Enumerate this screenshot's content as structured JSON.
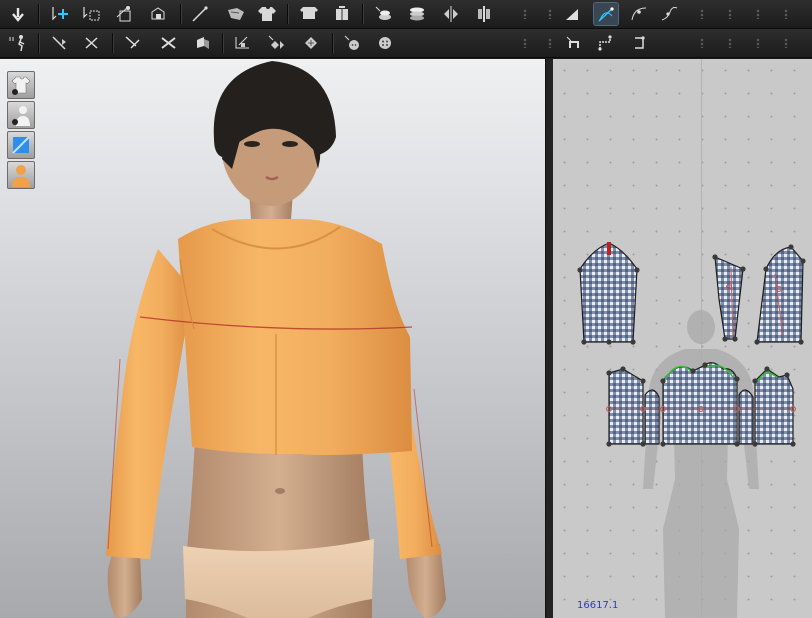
{
  "status": {
    "coordinate_readout": "16617.1"
  },
  "colors": {
    "garment": "#f2ad5e",
    "pattern_highlight": "#30c030",
    "active_tool": "#3a4752",
    "coordinate_text": "#2a3ad0"
  },
  "toolbar_top": {
    "icons": [
      "arrow-down-icon",
      "add-point-icon",
      "select-box-icon",
      "edit-pattern-icon",
      "transform-pattern-icon",
      "sewing-needle-icon",
      "fold-icon",
      "shirt-icon",
      "arrange-front-icon",
      "arrange-back-icon",
      "layer-icon",
      "stack-icon",
      "flip-icon",
      "mirror-icon",
      "trace-icon",
      "edit-curve-icon",
      "curve-point-icon",
      "curvature-icon"
    ],
    "active": "edit-curve-icon"
  },
  "toolbar_bottom": {
    "icons": [
      "avatar-walk-icon",
      "pin-icon",
      "pin-remove-icon",
      "tack-icon",
      "cut-icon",
      "attach-icon",
      "measure-icon",
      "texture-icon",
      "pattern-texture-icon",
      "button-icon",
      "buttonhole-icon",
      "segment-sew-icon",
      "free-sew-icon",
      "sew-edit-icon"
    ]
  },
  "view_tools": [
    "garment-display-icon",
    "avatar-display-icon",
    "texture-display-icon",
    "avatar-skin-icon"
  ]
}
